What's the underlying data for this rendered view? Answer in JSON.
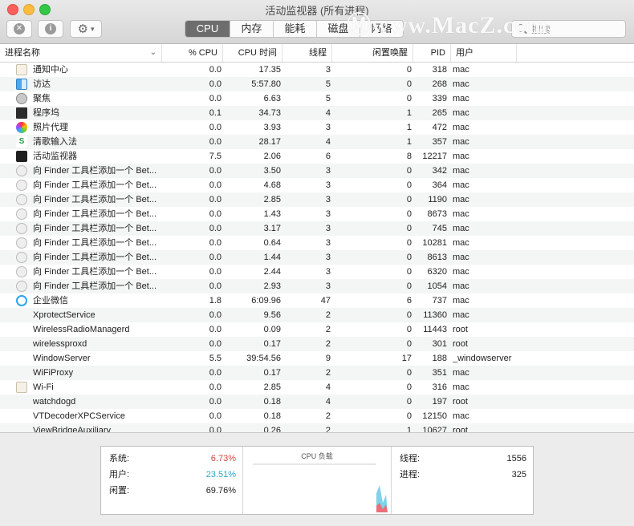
{
  "window": {
    "title": "活动监视器 (所有进程)",
    "watermark": "Ⓜwww.MacZ.com"
  },
  "toolbar": {
    "stop_glyph": "✕",
    "info_glyph": "i",
    "gear_glyph": "⚙",
    "gear_chevron": "▾",
    "tabs": [
      {
        "label": "CPU",
        "active": true
      },
      {
        "label": "内存",
        "active": false
      },
      {
        "label": "能耗",
        "active": false
      },
      {
        "label": "磁盘",
        "active": false
      },
      {
        "label": "网络",
        "active": false
      }
    ],
    "search_placeholder": "搜索"
  },
  "table": {
    "columns": {
      "name": "进程名称",
      "cpu": "% CPU",
      "cpu_time": "CPU 时间",
      "threads": "线程",
      "idle_wakeups": "闲置唤醒",
      "pid": "PID",
      "user": "用户"
    },
    "sort_glyph": "⌄",
    "rows": [
      {
        "icon": "doc",
        "name": "通知中心",
        "cpu": "0.0",
        "time": "17.35",
        "threads": "3",
        "idle": "0",
        "pid": "318",
        "user": "mac"
      },
      {
        "icon": "finder",
        "name": "访达",
        "cpu": "0.0",
        "time": "5:57.80",
        "threads": "5",
        "idle": "0",
        "pid": "268",
        "user": "mac"
      },
      {
        "icon": "spotlight",
        "name": "聚焦",
        "cpu": "0.0",
        "time": "6.63",
        "threads": "5",
        "idle": "0",
        "pid": "339",
        "user": "mac"
      },
      {
        "icon": "dock",
        "name": "程序坞",
        "cpu": "0.1",
        "time": "34.73",
        "threads": "4",
        "idle": "1",
        "pid": "265",
        "user": "mac"
      },
      {
        "icon": "photos",
        "name": "照片代理",
        "cpu": "0.0",
        "time": "3.93",
        "threads": "3",
        "idle": "1",
        "pid": "472",
        "user": "mac"
      },
      {
        "icon": "sogou",
        "name": "清歌输入法",
        "cpu": "0.0",
        "time": "28.17",
        "threads": "4",
        "idle": "1",
        "pid": "357",
        "user": "mac"
      },
      {
        "icon": "monitor",
        "name": "活动监视器",
        "cpu": "7.5",
        "time": "2.06",
        "threads": "6",
        "idle": "8",
        "pid": "12217",
        "user": "mac"
      },
      {
        "icon": "mail",
        "name": "向 Finder 工具栏添加一个 Bet...",
        "cpu": "0.0",
        "time": "3.50",
        "threads": "3",
        "idle": "0",
        "pid": "342",
        "user": "mac"
      },
      {
        "icon": "mail",
        "name": "向 Finder 工具栏添加一个 Bet...",
        "cpu": "0.0",
        "time": "4.68",
        "threads": "3",
        "idle": "0",
        "pid": "364",
        "user": "mac"
      },
      {
        "icon": "mail",
        "name": "向 Finder 工具栏添加一个 Bet...",
        "cpu": "0.0",
        "time": "2.85",
        "threads": "3",
        "idle": "0",
        "pid": "1190",
        "user": "mac"
      },
      {
        "icon": "mail",
        "name": "向 Finder 工具栏添加一个 Bet...",
        "cpu": "0.0",
        "time": "1.43",
        "threads": "3",
        "idle": "0",
        "pid": "8673",
        "user": "mac"
      },
      {
        "icon": "mail",
        "name": "向 Finder 工具栏添加一个 Bet...",
        "cpu": "0.0",
        "time": "3.17",
        "threads": "3",
        "idle": "0",
        "pid": "745",
        "user": "mac"
      },
      {
        "icon": "mail",
        "name": "向 Finder 工具栏添加一个 Bet...",
        "cpu": "0.0",
        "time": "0.64",
        "threads": "3",
        "idle": "0",
        "pid": "10281",
        "user": "mac"
      },
      {
        "icon": "mail",
        "name": "向 Finder 工具栏添加一个 Bet...",
        "cpu": "0.0",
        "time": "1.44",
        "threads": "3",
        "idle": "0",
        "pid": "8613",
        "user": "mac"
      },
      {
        "icon": "mail",
        "name": "向 Finder 工具栏添加一个 Bet...",
        "cpu": "0.0",
        "time": "2.44",
        "threads": "3",
        "idle": "0",
        "pid": "6320",
        "user": "mac"
      },
      {
        "icon": "mail",
        "name": "向 Finder 工具栏添加一个 Bet...",
        "cpu": "0.0",
        "time": "2.93",
        "threads": "3",
        "idle": "0",
        "pid": "1054",
        "user": "mac"
      },
      {
        "icon": "wecom",
        "name": "企业微信",
        "cpu": "1.8",
        "time": "6:09.96",
        "threads": "47",
        "idle": "6",
        "pid": "737",
        "user": "mac"
      },
      {
        "icon": "none",
        "name": "XprotectService",
        "cpu": "0.0",
        "time": "9.56",
        "threads": "2",
        "idle": "0",
        "pid": "11360",
        "user": "mac"
      },
      {
        "icon": "none",
        "name": "WirelessRadioManagerd",
        "cpu": "0.0",
        "time": "0.09",
        "threads": "2",
        "idle": "0",
        "pid": "11443",
        "user": "root"
      },
      {
        "icon": "none",
        "name": "wirelessproxd",
        "cpu": "0.0",
        "time": "0.17",
        "threads": "2",
        "idle": "0",
        "pid": "301",
        "user": "root"
      },
      {
        "icon": "none",
        "name": "WindowServer",
        "cpu": "5.5",
        "time": "39:54.56",
        "threads": "9",
        "idle": "17",
        "pid": "188",
        "user": "_windowserver"
      },
      {
        "icon": "none",
        "name": "WiFiProxy",
        "cpu": "0.0",
        "time": "0.17",
        "threads": "2",
        "idle": "0",
        "pid": "351",
        "user": "mac"
      },
      {
        "icon": "doc",
        "name": "Wi-Fi",
        "cpu": "0.0",
        "time": "2.85",
        "threads": "4",
        "idle": "0",
        "pid": "316",
        "user": "mac"
      },
      {
        "icon": "none",
        "name": "watchdogd",
        "cpu": "0.0",
        "time": "0.18",
        "threads": "4",
        "idle": "0",
        "pid": "197",
        "user": "root"
      },
      {
        "icon": "none",
        "name": "VTDecoderXPCService",
        "cpu": "0.0",
        "time": "0.18",
        "threads": "2",
        "idle": "0",
        "pid": "12150",
        "user": "mac"
      },
      {
        "icon": "none",
        "name": "ViewBridgeAuxiliary",
        "cpu": "0.0",
        "time": "0.26",
        "threads": "2",
        "idle": "1",
        "pid": "10627",
        "user": "root"
      }
    ]
  },
  "summary": {
    "system_label": "系统:",
    "system_value": "6.73%",
    "system_color": "#d64541",
    "user_label": "用户:",
    "user_value": "23.51%",
    "user_color": "#2aa7c9",
    "idle_label": "闲置:",
    "idle_value": "69.76%",
    "graph_title": "CPU 负载",
    "threads_label": "线程:",
    "threads_value": "1556",
    "processes_label": "进程:",
    "processes_value": "325"
  }
}
